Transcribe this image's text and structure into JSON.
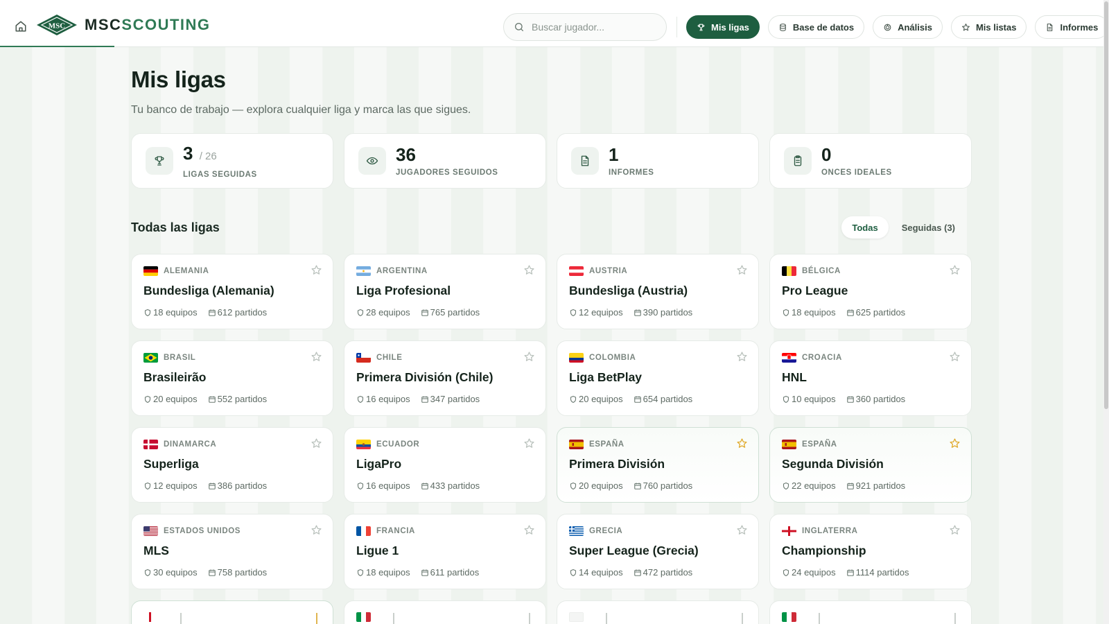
{
  "app": {
    "brand_part1": "MSC",
    "brand_part2": "SCOUTING",
    "badge_text": "MSC"
  },
  "search": {
    "placeholder": "Buscar jugador..."
  },
  "nav": [
    {
      "label": "Mis ligas",
      "icon": "trophy-icon",
      "active": true
    },
    {
      "label": "Base de datos",
      "icon": "database-icon",
      "active": false
    },
    {
      "label": "Análisis",
      "icon": "analysis-icon",
      "active": false
    },
    {
      "label": "Mis listas",
      "icon": "star-icon",
      "active": false
    },
    {
      "label": "Informes",
      "icon": "document-icon",
      "active": false
    }
  ],
  "page": {
    "title": "Mis ligas",
    "subtitle": "Tu banco de trabajo — explora cualquier liga y marca las que sigues."
  },
  "stats": [
    {
      "value": "3",
      "sub": "/ 26",
      "label": "LIGAS SEGUIDAS",
      "icon": "trophy-icon"
    },
    {
      "value": "36",
      "sub": "",
      "label": "JUGADORES SEGUIDOS",
      "icon": "eye-icon"
    },
    {
      "value": "1",
      "sub": "",
      "label": "INFORMES",
      "icon": "document-icon"
    },
    {
      "value": "0",
      "sub": "",
      "label": "ONCES IDEALES",
      "icon": "clipboard-icon"
    }
  ],
  "section": {
    "title": "Todas las ligas",
    "filter_all": "Todas",
    "filter_followed": "Seguidas (3)"
  },
  "leagues": [
    {
      "country": "ALEMANIA",
      "name": "Bundesliga (Alemania)",
      "teams": "18 equipos",
      "matches": "612 partidos",
      "followed": false,
      "flag": "de"
    },
    {
      "country": "ARGENTINA",
      "name": "Liga Profesional",
      "teams": "28 equipos",
      "matches": "765 partidos",
      "followed": false,
      "flag": "ar"
    },
    {
      "country": "AUSTRIA",
      "name": "Bundesliga (Austria)",
      "teams": "12 equipos",
      "matches": "390 partidos",
      "followed": false,
      "flag": "at"
    },
    {
      "country": "BÉLGICA",
      "name": "Pro League",
      "teams": "18 equipos",
      "matches": "625 partidos",
      "followed": false,
      "flag": "be"
    },
    {
      "country": "BRASIL",
      "name": "Brasileirão",
      "teams": "20 equipos",
      "matches": "552 partidos",
      "followed": false,
      "flag": "br"
    },
    {
      "country": "CHILE",
      "name": "Primera División (Chile)",
      "teams": "16 equipos",
      "matches": "347 partidos",
      "followed": false,
      "flag": "cl"
    },
    {
      "country": "COLOMBIA",
      "name": "Liga BetPlay",
      "teams": "20 equipos",
      "matches": "654 partidos",
      "followed": false,
      "flag": "co"
    },
    {
      "country": "CROACIA",
      "name": "HNL",
      "teams": "10 equipos",
      "matches": "360 partidos",
      "followed": false,
      "flag": "hr"
    },
    {
      "country": "DINAMARCA",
      "name": "Superliga",
      "teams": "12 equipos",
      "matches": "386 partidos",
      "followed": false,
      "flag": "dk"
    },
    {
      "country": "ECUADOR",
      "name": "LigaPro",
      "teams": "16 equipos",
      "matches": "433 partidos",
      "followed": false,
      "flag": "ec"
    },
    {
      "country": "ESPAÑA",
      "name": "Primera División",
      "teams": "20 equipos",
      "matches": "760 partidos",
      "followed": true,
      "flag": "es"
    },
    {
      "country": "ESPAÑA",
      "name": "Segunda División",
      "teams": "22 equipos",
      "matches": "921 partidos",
      "followed": true,
      "flag": "es"
    },
    {
      "country": "ESTADOS UNIDOS",
      "name": "MLS",
      "teams": "30 equipos",
      "matches": "758 partidos",
      "followed": false,
      "flag": "us"
    },
    {
      "country": "FRANCIA",
      "name": "Ligue 1",
      "teams": "18 equipos",
      "matches": "611 partidos",
      "followed": false,
      "flag": "fr"
    },
    {
      "country": "GRECIA",
      "name": "Super League (Grecia)",
      "teams": "14 equipos",
      "matches": "472 partidos",
      "followed": false,
      "flag": "gr"
    },
    {
      "country": "INGLATERRA",
      "name": "Championship",
      "teams": "24 equipos",
      "matches": "1114 partidos",
      "followed": false,
      "flag": "en"
    }
  ],
  "partial_cards": [
    {
      "followed": true,
      "flag": "partial-red"
    },
    {
      "followed": false,
      "flag": "it"
    },
    {
      "followed": false,
      "flag": "blank"
    },
    {
      "followed": false,
      "flag": "it"
    }
  ],
  "colors": {
    "brand": "#1e5e40",
    "accent": "#2f7a55",
    "star_followed": "#e0a92a",
    "star_default": "#b9c1bc"
  }
}
